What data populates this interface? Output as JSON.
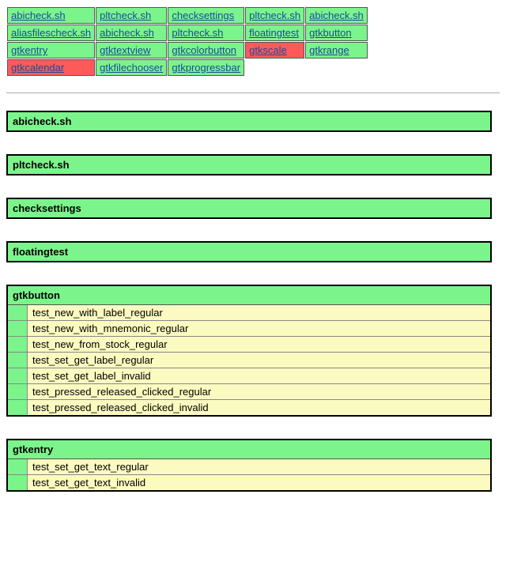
{
  "summary": {
    "rows": [
      [
        {
          "name": "abicheck.sh",
          "status": "pass"
        },
        {
          "name": "pltcheck.sh",
          "status": "pass"
        },
        {
          "name": "checksettings",
          "status": "pass"
        },
        {
          "name": "pltcheck.sh",
          "status": "pass"
        },
        {
          "name": "abicheck.sh",
          "status": "pass"
        }
      ],
      [
        {
          "name": "aliasfilescheck.sh",
          "status": "pass"
        },
        {
          "name": "abicheck.sh",
          "status": "pass"
        },
        {
          "name": "pltcheck.sh",
          "status": "pass"
        },
        {
          "name": "floatingtest",
          "status": "pass"
        },
        {
          "name": "gtkbutton",
          "status": "pass"
        }
      ],
      [
        {
          "name": "gtkentry",
          "status": "pass"
        },
        {
          "name": "gtktextview",
          "status": "pass"
        },
        {
          "name": "gtkcolorbutton",
          "status": "pass"
        },
        {
          "name": "gtkscale",
          "status": "fail"
        },
        {
          "name": "gtkrange",
          "status": "pass"
        }
      ],
      [
        {
          "name": "gtkcalendar",
          "status": "fail"
        },
        {
          "name": "gtkfilechooser",
          "status": "pass"
        },
        {
          "name": "gtkprogressbar",
          "status": "pass"
        }
      ]
    ]
  },
  "details": [
    {
      "title": "abicheck.sh",
      "status": "pass",
      "tests": []
    },
    {
      "title": "pltcheck.sh",
      "status": "pass",
      "tests": []
    },
    {
      "title": "checksettings",
      "status": "pass",
      "tests": []
    },
    {
      "title": "floatingtest",
      "status": "pass",
      "tests": []
    },
    {
      "title": "gtkbutton",
      "status": "pass",
      "tests": [
        "test_new_with_label_regular",
        "test_new_with_mnemonic_regular",
        "test_new_from_stock_regular",
        "test_set_get_label_regular",
        "test_set_get_label_invalid",
        "test_pressed_released_clicked_regular",
        "test_pressed_released_clicked_invalid"
      ]
    },
    {
      "title": "gtkentry",
      "status": "pass",
      "tests": [
        "test_set_get_text_regular",
        "test_set_get_text_invalid"
      ]
    }
  ]
}
